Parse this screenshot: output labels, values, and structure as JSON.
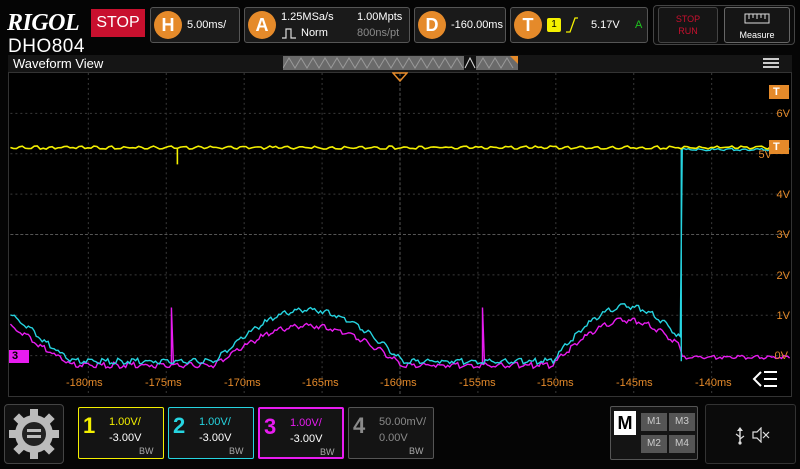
{
  "brand": {
    "logo": "RIGOL",
    "status": "STOP",
    "model": "DHO804"
  },
  "horizontal": {
    "key": "H",
    "timebase": "5.00ms/"
  },
  "acquisition": {
    "key": "A",
    "sample_rate": "1.25MSa/s",
    "memory_depth": "1.00Mpts",
    "mode": "Norm",
    "sample_period": "800ns/pt"
  },
  "delay": {
    "key": "D",
    "value": "-160.00ms"
  },
  "trigger": {
    "key": "T",
    "source": "1",
    "slope": "rising",
    "level": "5.17V",
    "mode_flag": "A"
  },
  "buttons": {
    "stop_run_top": "STOP",
    "stop_run_bottom": "RUN",
    "measure": "Measure"
  },
  "view": {
    "title": "Waveform View"
  },
  "markers": {
    "trigger_marker": "T",
    "trigger_level_marker": "T",
    "channel3_ground": "3"
  },
  "colors": {
    "ch1": "#f4f000",
    "ch2": "#26d4e0",
    "ch3": "#e81cf0",
    "ch4": "#8a8a8a",
    "accent": "#e58a2a",
    "stop": "#c8102e"
  },
  "vertical_scale": [
    "6V",
    "5V",
    "4V",
    "3V",
    "2V",
    "1V",
    "0V"
  ],
  "time_labels": [
    "-180ms",
    "-175ms",
    "-170ms",
    "-165ms",
    "-160ms",
    "-155ms",
    "-150ms",
    "-145ms",
    "-140ms"
  ],
  "channels": [
    {
      "num": "1",
      "scale": "1.00V/",
      "offset": "-3.00V",
      "bw": "BW",
      "active": true
    },
    {
      "num": "2",
      "scale": "1.00V/",
      "offset": "-3.00V",
      "bw": "BW",
      "active": true
    },
    {
      "num": "3",
      "scale": "1.00V/",
      "offset": "-3.00V",
      "bw": "BW",
      "active": true
    },
    {
      "num": "4",
      "scale": "50.00mV/",
      "offset": "0.00V",
      "bw": "BW",
      "active": false
    }
  ],
  "math": {
    "key": "M",
    "items": [
      "M1",
      "M3",
      "M2",
      "M4"
    ]
  },
  "icons": {
    "menu": "hamburger-icon",
    "collapse": "collapse-menu-icon",
    "home": "gear-home-icon",
    "usb": "usb-icon",
    "mute": "speaker-mute-icon"
  }
}
